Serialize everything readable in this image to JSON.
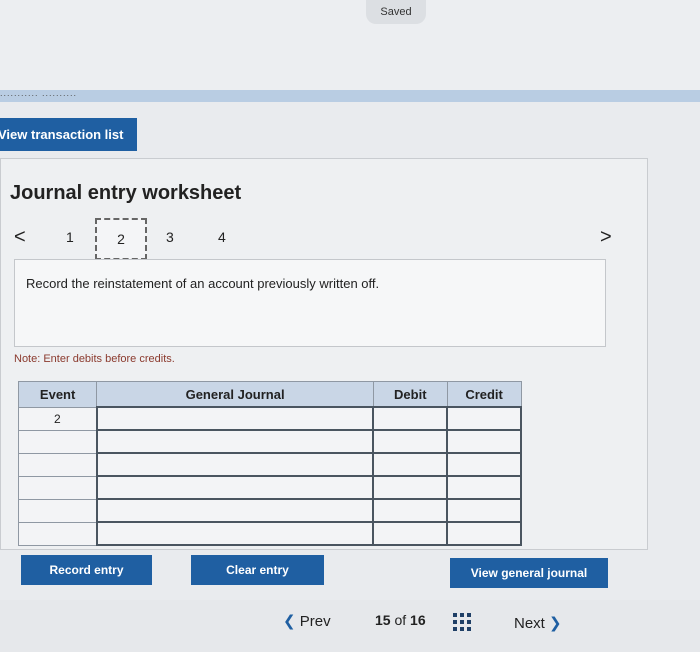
{
  "status": {
    "saved_label": "Saved"
  },
  "header": {
    "history_fragment": "...........  ..........",
    "view_transactions_label": "View transaction list"
  },
  "worksheet": {
    "title": "Journal entry worksheet",
    "nav": {
      "prev_arrow": "<",
      "next_arrow": ">",
      "steps": [
        "1",
        "2",
        "3",
        "4"
      ],
      "active_step": "2"
    },
    "instruction": "Record the reinstatement of an account previously written off.",
    "note": "Note: Enter debits before credits."
  },
  "journal_table": {
    "headers": {
      "event": "Event",
      "general_journal": "General Journal",
      "debit": "Debit",
      "credit": "Credit"
    },
    "rows": [
      {
        "event": "2",
        "account": "",
        "debit": "",
        "credit": ""
      },
      {
        "event": "",
        "account": "",
        "debit": "",
        "credit": ""
      },
      {
        "event": "",
        "account": "",
        "debit": "",
        "credit": ""
      },
      {
        "event": "",
        "account": "",
        "debit": "",
        "credit": ""
      },
      {
        "event": "",
        "account": "",
        "debit": "",
        "credit": ""
      },
      {
        "event": "",
        "account": "",
        "debit": "",
        "credit": ""
      }
    ]
  },
  "actions": {
    "record_label": "Record entry",
    "clear_label": "Clear entry",
    "view_journal_label": "View general journal"
  },
  "pagination": {
    "prev_label": "Prev",
    "current": "15",
    "of_label": "of",
    "total": "16",
    "next_label": "Next",
    "grid_icon": "grid-icon"
  },
  "colors": {
    "accent": "#1f5fa2",
    "table_header": "#c9d6e6",
    "note_text": "#8b3a2e"
  }
}
